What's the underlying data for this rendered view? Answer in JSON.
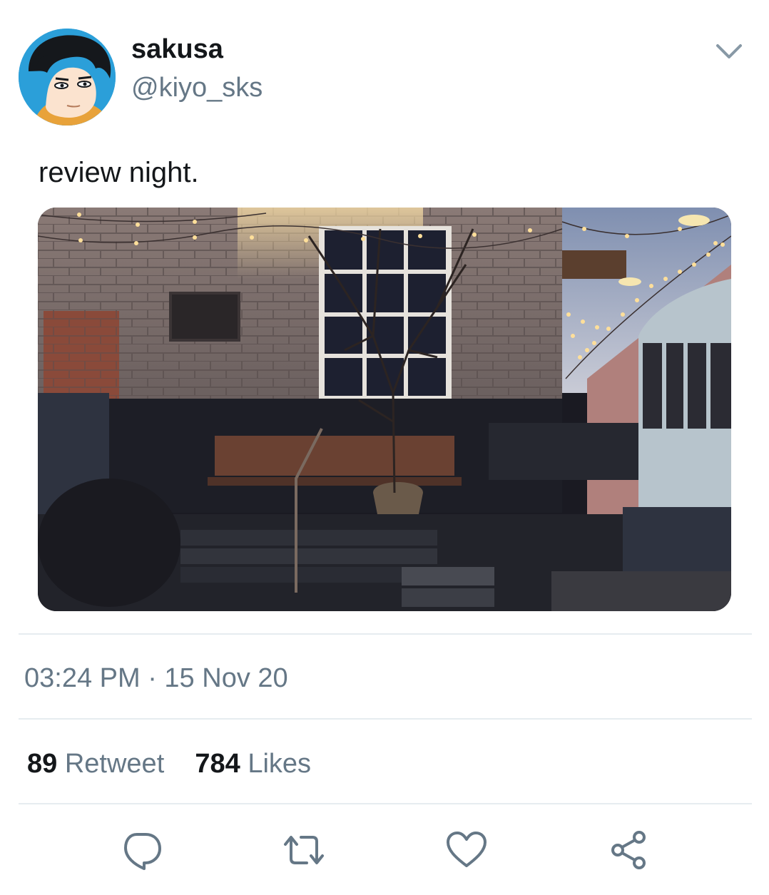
{
  "user": {
    "display_name": "sakusa",
    "handle": "@kiyo_sks"
  },
  "tweet": {
    "text": "review night.",
    "timestamp": "03:24 PM · 15 Nov 20"
  },
  "stats": {
    "retweet_count": "89",
    "retweet_label": "Retweet",
    "likes_count": "784",
    "likes_label": "Likes"
  },
  "actions": [
    {
      "icon": "reply-icon"
    },
    {
      "icon": "retweet-icon"
    },
    {
      "icon": "like-icon"
    },
    {
      "icon": "share-icon"
    }
  ],
  "colors": {
    "primary_text": "#14171a",
    "secondary_text": "#657786",
    "divider": "#e6ecf0",
    "icon": "#657786"
  }
}
